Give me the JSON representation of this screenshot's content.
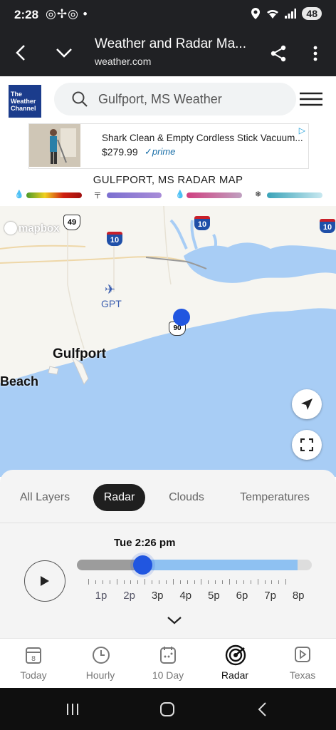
{
  "status_bar": {
    "time": "2:28",
    "notification_icons": "◎✢◎ •",
    "battery": "48"
  },
  "app_bar": {
    "title": "Weather and Radar Ma...",
    "subtitle": "weather.com"
  },
  "header": {
    "logo_text": "The Weather Channel",
    "search_placeholder": "Gulfport, MS Weather"
  },
  "ad": {
    "title": "Shark Clean & Empty Cordless Stick Vacuum...",
    "price": "$279.99",
    "badge": "✓prime"
  },
  "radar": {
    "title": "GULFPORT, MS RADAR MAP",
    "legend": [
      {
        "icon": "rain-icon",
        "colors": [
          "#4a9a2a",
          "#f0d020",
          "#d02010",
          "#a01010"
        ]
      },
      {
        "icon": "mix-icon",
        "colors": [
          "#7b6fd0",
          "#a88cd8"
        ]
      },
      {
        "icon": "ice-icon",
        "colors": [
          "#d04080",
          "#c0a0c0"
        ]
      },
      {
        "icon": "snow-icon",
        "colors": [
          "#3aa3b8",
          "#c8e8f0"
        ]
      }
    ]
  },
  "map": {
    "attribution": "mapbox",
    "labels": {
      "city": "Gulfport",
      "beach": "Beach",
      "airport": "GPT",
      "hwy49": "49",
      "hwy90": "90",
      "i10": "10"
    }
  },
  "layers": {
    "tabs": [
      "All Layers",
      "Radar",
      "Clouds",
      "Temperatures"
    ],
    "active": "Radar"
  },
  "timeline": {
    "current_time": "Tue 2:26 pm",
    "hours": [
      "1p",
      "2p",
      "3p",
      "4p",
      "5p",
      "6p",
      "7p",
      "8p"
    ],
    "position_fraction": 0.28
  },
  "bottom_nav": {
    "items": [
      {
        "label": "Today",
        "icon": "calendar-day-icon",
        "badge": "8"
      },
      {
        "label": "Hourly",
        "icon": "clock-icon"
      },
      {
        "label": "10 Day",
        "icon": "calendar-icon"
      },
      {
        "label": "Radar",
        "icon": "radar-icon"
      },
      {
        "label": "Texas",
        "icon": "video-icon"
      }
    ],
    "active": "Radar"
  },
  "colors": {
    "dark_bar": "#202124",
    "water": "#a8cdf5",
    "land": "#f6f5f0",
    "accent_blue": "#2156e0"
  }
}
